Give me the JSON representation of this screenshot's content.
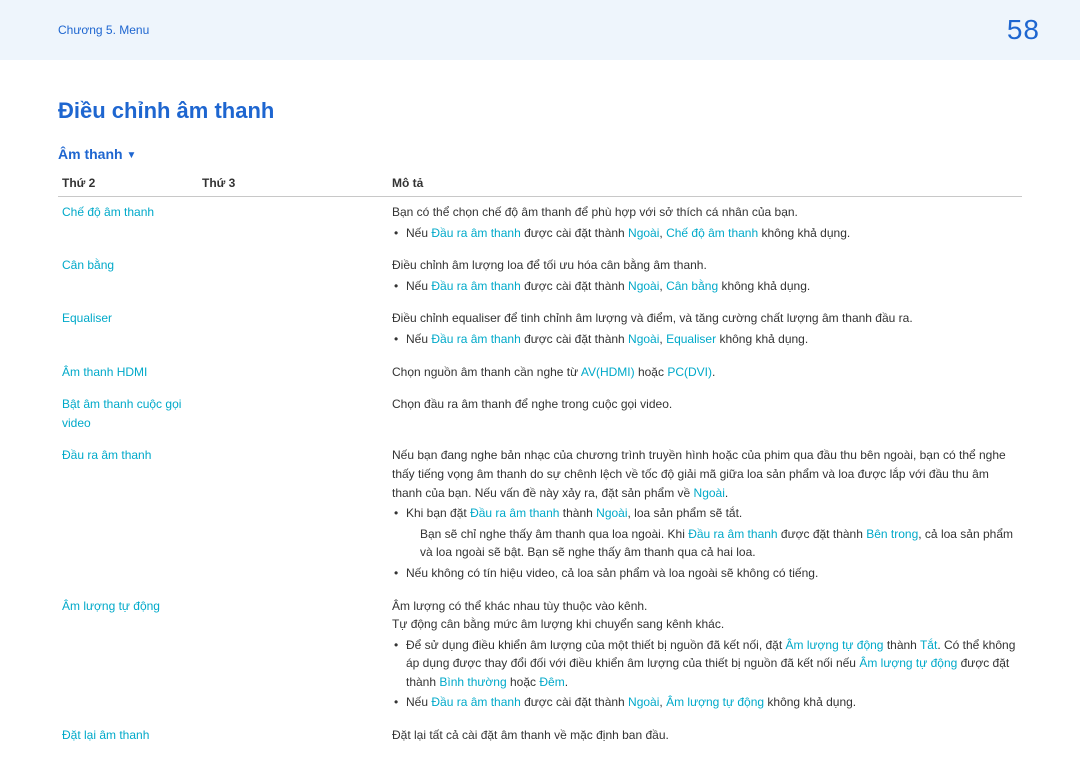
{
  "header": {
    "chapter": "Chương 5. Menu",
    "page_number": "58"
  },
  "section_title": "Điều chỉnh âm thanh",
  "subsection_label": "Âm thanh",
  "table": {
    "headers": {
      "c1": "Thứ 2",
      "c2": "Thứ 3",
      "c3": "Mô tả"
    }
  },
  "rows": {
    "mode": {
      "label": "Chế độ âm thanh",
      "desc": "Bạn có thể chọn chế độ âm thanh để phù hợp với sở thích cá nhân của bạn.",
      "note_pre": "Nếu ",
      "note_kw1": "Đầu ra âm thanh",
      "note_mid": " được cài đặt thành ",
      "note_kw2": "Ngoài",
      "note_sep": ", ",
      "note_kw3": "Chế độ âm thanh",
      "note_post": " không khả dụng."
    },
    "balance": {
      "label": "Cân bằng",
      "desc": "Điều chỉnh âm lượng loa để tối ưu hóa cân bằng âm thanh.",
      "note_pre": "Nếu ",
      "note_kw1": "Đầu ra âm thanh",
      "note_mid": " được cài đặt thành ",
      "note_kw2": "Ngoài",
      "note_sep": ", ",
      "note_kw3": "Cân bằng",
      "note_post": " không khả dụng."
    },
    "equaliser": {
      "label": "Equaliser",
      "desc": "Điều chỉnh equaliser để tinh chỉnh âm lượng và điểm, và tăng cường chất lượng âm thanh đầu ra.",
      "note_pre": "Nếu ",
      "note_kw1": "Đầu ra âm thanh",
      "note_mid": " được cài đặt thành ",
      "note_kw2": "Ngoài",
      "note_sep": ", ",
      "note_kw3": "Equaliser",
      "note_post": " không khả dụng."
    },
    "hdmi": {
      "label": "Âm thanh HDMI",
      "desc_pre": "Chọn nguồn âm thanh cần nghe từ ",
      "kw1": "AV(HDMI)",
      "mid": " hoặc ",
      "kw2": "PC(DVI)",
      "post": "."
    },
    "videocall": {
      "label_l1": "Bật âm thanh cuộc gọi",
      "label_l2": "video",
      "desc": "Chọn đầu ra âm thanh để nghe trong cuộc gọi video."
    },
    "output": {
      "label": "Đầu ra âm thanh",
      "p_pre": "Nếu bạn đang nghe bản nhạc của chương trình truyền hình hoặc của phim qua đầu thu bên ngoài, bạn có thể nghe thấy tiếng vọng âm thanh do sự chênh lệch về tốc độ giải mã giữa loa sản phẩm và loa được lắp với đầu thu âm thanh của bạn. Nếu vấn đề này xảy ra, đặt sản phẩm về ",
      "p_kw": "Ngoài",
      "p_post": ".",
      "b1_pre": "Khi bạn đặt ",
      "b1_kw1": "Đầu ra âm thanh",
      "b1_mid": " thành ",
      "b1_kw2": "Ngoài",
      "b1_post": ", loa sản phẩm sẽ tắt.",
      "b1_sub_pre": "Bạn sẽ chỉ nghe thấy âm thanh qua loa ngoài. Khi ",
      "b1_sub_kw1": "Đầu ra âm thanh",
      "b1_sub_mid": " được đặt thành ",
      "b1_sub_kw2": "Bên trong",
      "b1_sub_post": ", cả loa sản phẩm và loa ngoài sẽ bật. Bạn sẽ nghe thấy âm thanh qua cả hai loa.",
      "b2": "Nếu không có tín hiệu video, cả loa sản phẩm và loa ngoài sẽ không có tiếng."
    },
    "autovol": {
      "label": "Âm lượng tự động",
      "p1": "Âm lượng có thể khác nhau tùy thuộc vào kênh.",
      "p2": "Tự động cân bằng mức âm lượng khi chuyển sang kênh khác.",
      "b1_pre": "Để sử dụng điều khiển âm lượng của một thiết bị nguồn đã kết nối, đặt ",
      "b1_kw1": "Âm lượng tự động",
      "b1_mid": " thành ",
      "b1_kw2": "Tắt",
      "b1_post_a": ". Có thể không áp dụng được thay đổi đối với điều khiển âm lượng của thiết bị nguồn đã kết nối nếu ",
      "b1_kw3": "Âm lượng tự động",
      "b1_post_b": " được đặt thành ",
      "b1_kw4": "Bình thường",
      "b1_or": " hoặc ",
      "b1_kw5": "Đêm",
      "b1_end": ".",
      "b2_pre": "Nếu ",
      "b2_kw1": "Đầu ra âm thanh",
      "b2_mid": " được cài đặt thành ",
      "b2_kw2": "Ngoài",
      "b2_sep": ", ",
      "b2_kw3": "Âm lượng tự động",
      "b2_post": " không khả dụng."
    },
    "reset": {
      "label": "Đặt lại âm thanh",
      "desc": "Đặt lại tất cả cài đặt âm thanh về mặc định ban đầu."
    }
  }
}
